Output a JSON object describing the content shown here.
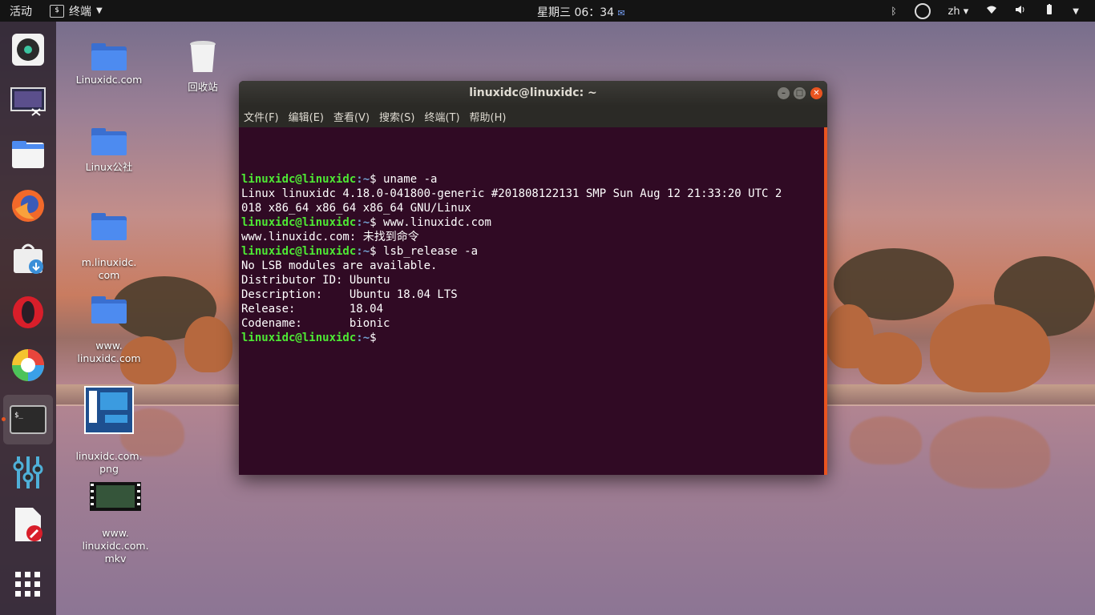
{
  "topbar": {
    "activities": "活动",
    "app_name": "终端",
    "clock": "星期三 06：34",
    "lang": "zh"
  },
  "dock": {
    "items": [
      {
        "name": "rhythmbox-icon"
      },
      {
        "name": "screenshot-icon"
      },
      {
        "name": "files-icon"
      },
      {
        "name": "firefox-icon"
      },
      {
        "name": "software-center-icon"
      },
      {
        "name": "opera-icon"
      },
      {
        "name": "color-picker-icon"
      },
      {
        "name": "terminal-icon",
        "active": true
      },
      {
        "name": "settings-mixer-icon"
      },
      {
        "name": "text-editor-icon"
      },
      {
        "name": "app-grid-icon"
      }
    ]
  },
  "desktop": {
    "icons": [
      {
        "label": "Linuxidc.com",
        "kind": "folder"
      },
      {
        "label": "回收站",
        "kind": "trash"
      },
      {
        "label": "Linux公社",
        "kind": "folder"
      },
      {
        "label": "m.linuxidc.\ncom",
        "kind": "folder"
      },
      {
        "label": "www.\nlinuxidc.com",
        "kind": "folder"
      },
      {
        "label": "linuxidc.com.\npng",
        "kind": "image"
      },
      {
        "label": "www.\nlinuxidc.com.\nmkv",
        "kind": "video"
      }
    ]
  },
  "terminal": {
    "title": "linuxidc@linuxidc: ~",
    "menu": [
      "文件(F)",
      "编辑(E)",
      "查看(V)",
      "搜索(S)",
      "终端(T)",
      "帮助(H)"
    ],
    "prompt_user": "linuxidc@linuxidc",
    "prompt_path": ":~",
    "prompt_symbol": "$",
    "lines": [
      {
        "type": "cmd",
        "text": " uname -a"
      },
      {
        "type": "out",
        "text": "Linux linuxidc 4.18.0-041800-generic #201808122131 SMP Sun Aug 12 21:33:20 UTC 2"
      },
      {
        "type": "out",
        "text": "018 x86_64 x86_64 x86_64 GNU/Linux"
      },
      {
        "type": "cmd",
        "text": " www.linuxidc.com"
      },
      {
        "type": "out",
        "text": "www.linuxidc.com: 未找到命令"
      },
      {
        "type": "cmd",
        "text": " lsb_release -a"
      },
      {
        "type": "out",
        "text": "No LSB modules are available."
      },
      {
        "type": "out",
        "text": "Distributor ID:\tUbuntu"
      },
      {
        "type": "out",
        "text": "Description:\tUbuntu 18.04 LTS"
      },
      {
        "type": "out",
        "text": "Release:\t18.04"
      },
      {
        "type": "out",
        "text": "Codename:\tbionic"
      },
      {
        "type": "cmd",
        "text": ""
      }
    ]
  },
  "colors": {
    "terminal_bg": "#300a24",
    "prompt_green": "#4ee934",
    "prompt_blue": "#729fcf",
    "accent": "#e95420"
  }
}
